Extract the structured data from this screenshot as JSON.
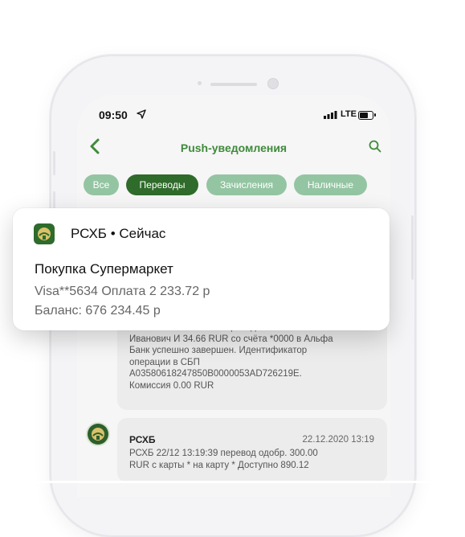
{
  "status_bar": {
    "time": "09:50",
    "network": "LTE"
  },
  "nav": {
    "title": "Push-уведомления"
  },
  "filters": [
    {
      "label": "Все",
      "active": false
    },
    {
      "label": "Переводы",
      "active": true
    },
    {
      "label": "Зачисления",
      "active": false
    },
    {
      "label": "Наличные",
      "active": false
    }
  ],
  "messages": [
    {
      "lines": [
        "РСХБ 23/12 09:16:31 перевод СБП Иван",
        "Иванович  И  34.66 RUR со счёта *0000 в Альфа",
        "Банк успешно завершен. Идентификатор",
        "операции в СБП",
        "A03580618247850B0000053AD726219E.",
        "Комиссия 0.00 RUR"
      ]
    },
    {
      "sender": "РСХБ",
      "date": "22.12.2020 13:19",
      "lines": [
        "РСХБ 22/12 13:19:39 перевод одобр. 300.00",
        "RUR с карты * на карту * Доступно 890.12"
      ]
    }
  ],
  "notification": {
    "header": "РСХБ • Сейчас",
    "title": "Покупка Супермаркет",
    "line1": "Visa**5634 Оплата 2 233.72 р",
    "line2": "Баланс: 676 234.45 р"
  },
  "colors": {
    "brand_green": "#2f6b2a",
    "chip_green": "#94c5a2",
    "title_green": "#3f8a3a"
  }
}
